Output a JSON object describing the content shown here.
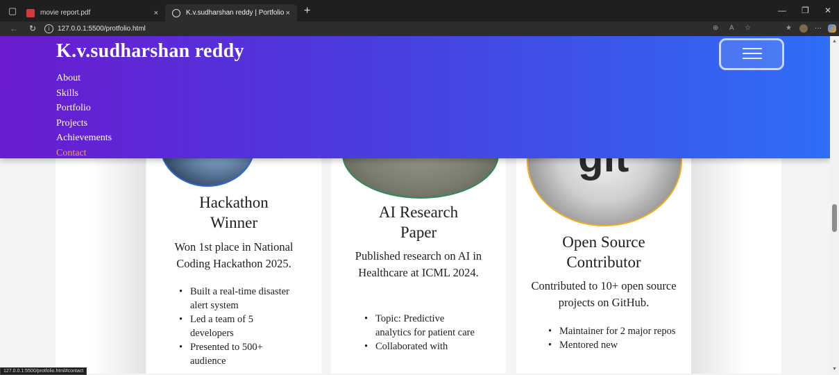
{
  "browser": {
    "tabs": [
      {
        "title": "movie report.pdf",
        "active": false,
        "icon": "pdf-icon"
      },
      {
        "title": "K.v.sudharshan reddy | Portfolio",
        "active": true,
        "icon": "globe-icon"
      }
    ],
    "new_tab": "+",
    "close": "×",
    "url": "127.0.0.1:5500/protfolio.html",
    "status_url": "127.0.0.1:5500/protfolio.html#contact"
  },
  "header": {
    "brand": "K.v.sudharshan reddy",
    "menu": [
      "About",
      "Skills",
      "Portfolio",
      "Projects",
      "Achievements",
      "Contact"
    ],
    "active_color": "#f2a341"
  },
  "cards": [
    {
      "title": "Hackathon Winner",
      "description": "Won 1st place in National Coding Hackathon 2025.",
      "bullets": [
        "Built a real-time disaster alert system",
        "Led a team of 5 developers",
        "Presented to 500+ audience"
      ],
      "ring_color": "#2d6ad8"
    },
    {
      "title": "AI Research Paper",
      "description": "Published research on AI in Healthcare at ICML 2024.",
      "bullets": [
        "Topic: Predictive analytics for patient care",
        "Collaborated with"
      ],
      "ring_color": "#2e8b57"
    },
    {
      "title": "Open Source Contributor",
      "description": "Contributed to 10+ open source projects on GitHub.",
      "bullets": [
        "Maintainer for 2 major repos",
        "Mentored new"
      ],
      "ring_color": "#f0b020"
    }
  ]
}
